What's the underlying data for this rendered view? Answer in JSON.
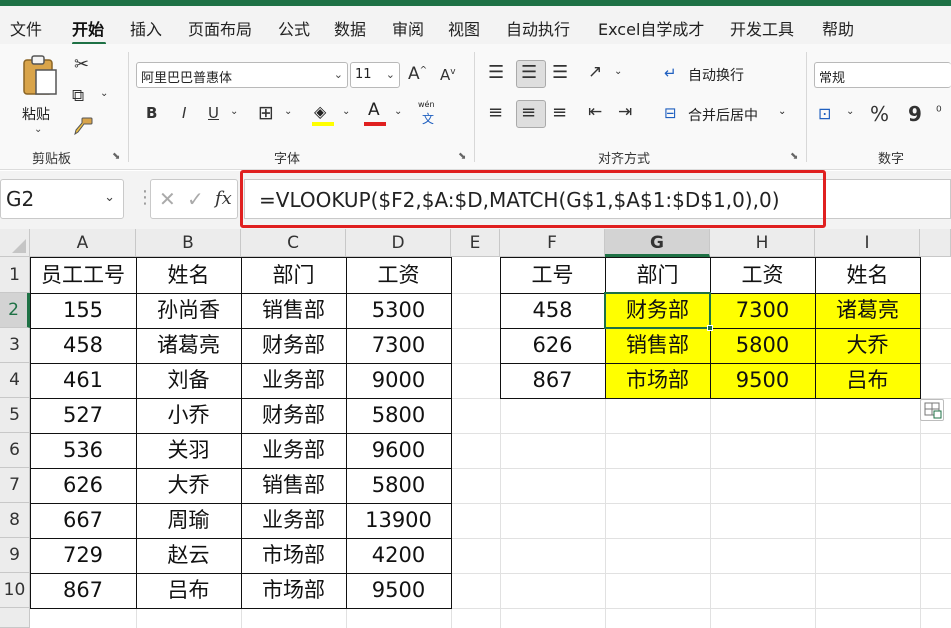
{
  "menu": {
    "items": [
      "文件",
      "开始",
      "插入",
      "页面布局",
      "公式",
      "数据",
      "审阅",
      "视图",
      "自动执行",
      "Excel自学成才",
      "开发工具",
      "帮助"
    ],
    "active_index": 1
  },
  "ribbon": {
    "clipboard": {
      "group_label": "剪贴板",
      "paste_label": "粘贴"
    },
    "font": {
      "group_label": "字体",
      "font_name": "阿里巴巴普惠体",
      "font_size": "11",
      "bold": "B",
      "italic": "I",
      "underline": "U",
      "wen_label": "wén",
      "wen_char": "文"
    },
    "alignment": {
      "group_label": "对齐方式",
      "wrap_label": "自动换行",
      "merge_label": "合并后居中"
    },
    "number": {
      "group_label": "数字",
      "format": "常规",
      "percent": "%",
      "comma": "9"
    }
  },
  "formula_bar": {
    "name_box": "G2",
    "fx": "fx",
    "formula": "=VLOOKUP($F2,$A:$D,MATCH(G$1,$A$1:$D$1,0),0)"
  },
  "sheet": {
    "columns": [
      "A",
      "B",
      "C",
      "D",
      "E",
      "F",
      "G",
      "H",
      "I"
    ],
    "selected_column": "G",
    "rows": [
      "1",
      "2",
      "3",
      "4",
      "5",
      "6",
      "7",
      "8",
      "9",
      "10"
    ],
    "selected_row": "2",
    "left_table": {
      "header": [
        "员工工号",
        "姓名",
        "部门",
        "工资"
      ],
      "rows": [
        [
          "155",
          "孙尚香",
          "销售部",
          "5300"
        ],
        [
          "458",
          "诸葛亮",
          "财务部",
          "7300"
        ],
        [
          "461",
          "刘备",
          "业务部",
          "9000"
        ],
        [
          "527",
          "小乔",
          "财务部",
          "5800"
        ],
        [
          "536",
          "关羽",
          "业务部",
          "9600"
        ],
        [
          "626",
          "大乔",
          "销售部",
          "5800"
        ],
        [
          "667",
          "周瑜",
          "业务部",
          "13900"
        ],
        [
          "729",
          "赵云",
          "市场部",
          "4200"
        ],
        [
          "867",
          "吕布",
          "市场部",
          "9500"
        ]
      ]
    },
    "right_table": {
      "header": [
        "工号",
        "部门",
        "工资",
        "姓名"
      ],
      "rows": [
        [
          "458",
          "财务部",
          "7300",
          "诸葛亮"
        ],
        [
          "626",
          "销售部",
          "5800",
          "大乔"
        ],
        [
          "867",
          "市场部",
          "9500",
          "吕布"
        ]
      ]
    },
    "highlight_color": "#ffff00",
    "accent_color": "#1e7145",
    "callout_color": "#e02020"
  }
}
